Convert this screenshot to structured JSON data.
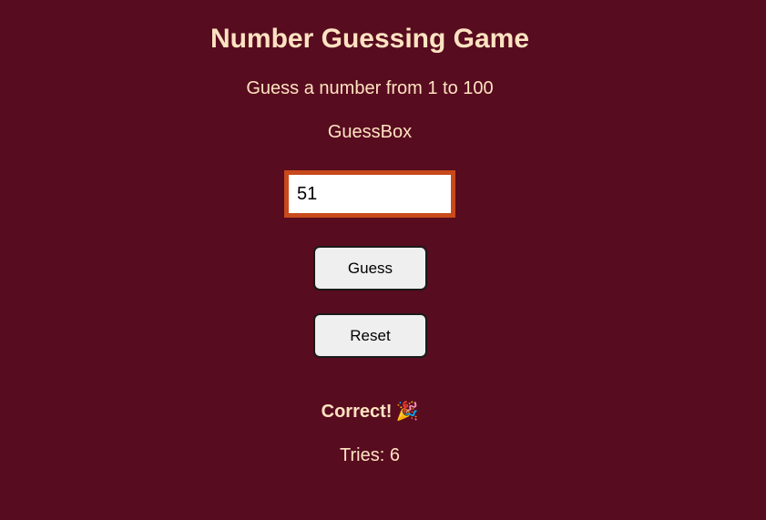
{
  "game": {
    "title": "Number Guessing Game",
    "subtitle": "Guess a number from 1 to 100",
    "input_label": "GuessBox",
    "input_value": "51",
    "guess_button": "Guess",
    "reset_button": "Reset",
    "result_message": "Correct!",
    "result_icon": "party-popper-icon",
    "result_emoji": "🎉",
    "tries_text": "Tries: 6"
  },
  "colors": {
    "background": "#580c1f",
    "text": "#ffe3c2",
    "input_border": "#c8491c",
    "button_bg": "#efefef"
  }
}
